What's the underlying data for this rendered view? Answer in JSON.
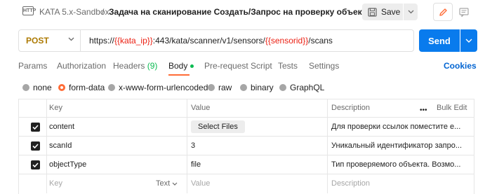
{
  "header": {
    "badge": "HTTP",
    "collection": "KATA 5.x-Sandbox",
    "separator": "/",
    "request_name": "Задача на сканирование Создать/Запрос на проверку объектов",
    "save_label": "Save"
  },
  "url_bar": {
    "method": "POST",
    "url_prefix": "https://",
    "var1": "{{kata_ip}}",
    "url_mid": ":443/kata/scanner/v1/sensors/",
    "var2": "{{sensorid}}",
    "url_suffix": "/scans",
    "send_label": "Send"
  },
  "tabs": {
    "params": "Params",
    "authorization": "Authorization",
    "headers": "Headers",
    "headers_count": "(9)",
    "body": "Body",
    "prerequest": "Pre-request Script",
    "tests": "Tests",
    "settings": "Settings",
    "cookies": "Cookies"
  },
  "body_types": {
    "none": "none",
    "form_data": "form-data",
    "urlencoded": "x-www-form-urlencoded",
    "raw": "raw",
    "binary": "binary",
    "graphql": "GraphQL",
    "selected": "form-data"
  },
  "table": {
    "headers": {
      "key": "Key",
      "value": "Value",
      "description": "Description",
      "bulk_edit": "Bulk Edit"
    },
    "rows": [
      {
        "key": "content",
        "value": "Select Files",
        "description": "Для проверки ссылок поместите е...",
        "checked": true
      },
      {
        "key": "scanId",
        "value": "3",
        "description": "Уникальный идентификатор запро...",
        "checked": true
      },
      {
        "key": "objectType",
        "value": "file",
        "description": "Тип проверяемого объекта. Возмо...",
        "checked": true
      }
    ],
    "new_row": {
      "key_placeholder": "Key",
      "type_label": "Text",
      "value_placeholder": "Value",
      "description_placeholder": "Description"
    }
  },
  "colors": {
    "accent": "#ff6c37",
    "send": "#097bed",
    "method": "#ad7a03",
    "variable": "#eb2013",
    "success": "#0cbb52"
  }
}
